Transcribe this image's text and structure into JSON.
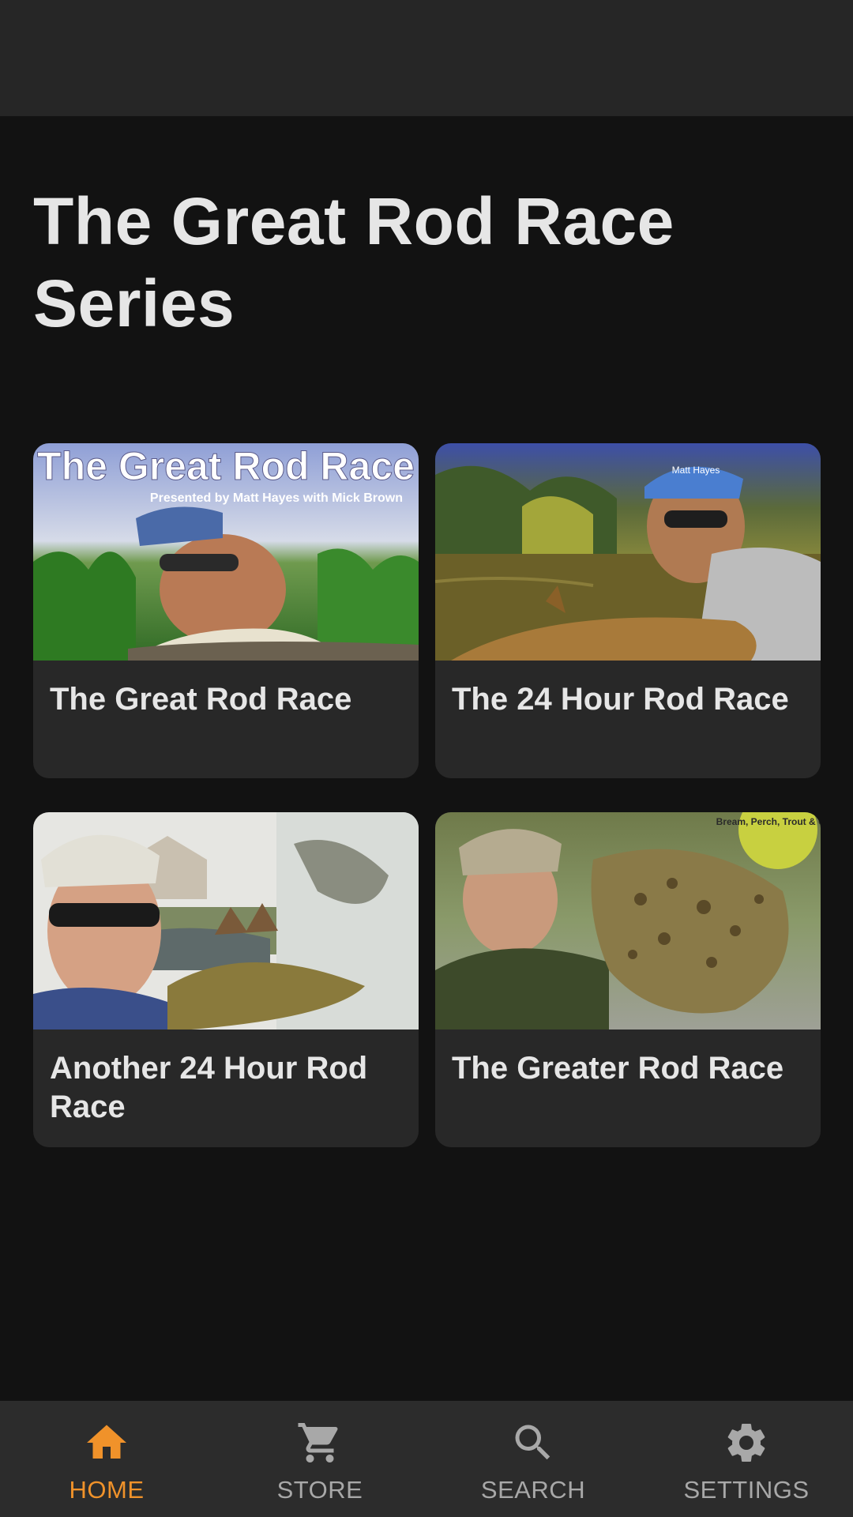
{
  "page": {
    "title": "The Great Rod Race Series"
  },
  "episodes": [
    {
      "title": "The Great Rod Race",
      "cover_title": "The Great Rod Race",
      "cover_subtitle": "Presented by Matt Hayes with Mick Brown"
    },
    {
      "title": "The 24 Hour Rod Race",
      "cap_text": "Matt Hayes"
    },
    {
      "title": "Another 24 Hour Rod Race"
    },
    {
      "title": "The Greater Rod Race",
      "badge_text": "Bream, Perch, Trout & Carp"
    }
  ],
  "nav": {
    "items": [
      {
        "label": "HOME",
        "icon": "home-icon",
        "active": true
      },
      {
        "label": "STORE",
        "icon": "cart-icon",
        "active": false
      },
      {
        "label": "SEARCH",
        "icon": "search-icon",
        "active": false
      },
      {
        "label": "SETTINGS",
        "icon": "gear-icon",
        "active": false
      }
    ]
  },
  "colors": {
    "accent": "#f0922a",
    "background": "#121212",
    "card": "#282828",
    "nav": "#2c2c2c"
  }
}
